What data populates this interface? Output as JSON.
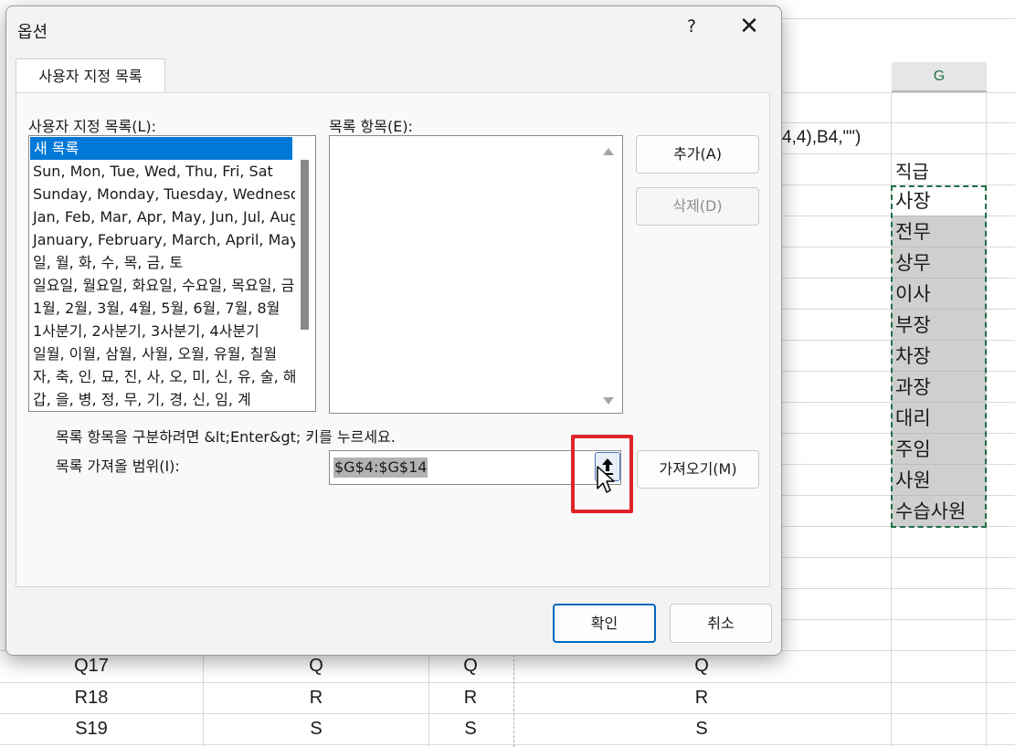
{
  "dialog": {
    "title": "옵션",
    "help_label": "?",
    "close_label": "✕",
    "tab_label": "사용자 지정 목록",
    "custom_lists_label": "사용자 지정 목록(L):",
    "custom_lists": [
      "새 목록",
      "Sun, Mon, Tue, Wed, Thu, Fri, Sat",
      "Sunday, Monday, Tuesday, Wednesday, Thursday, Friday, Saturday",
      "Jan, Feb, Mar, Apr, May, Jun, Jul, Aug, Sep, Oct, Nov, Dec",
      "January, February, March, April, May, June, July",
      "일, 월, 화, 수, 목, 금, 토",
      "일요일, 월요일, 화요일, 수요일, 목요일, 금요일, 토요일",
      "1월, 2월, 3월, 4월, 5월, 6월, 7월, 8월",
      "1사분기, 2사분기, 3사분기, 4사분기",
      "일월, 이월, 삼월, 사월, 오월, 유월, 칠월",
      "자, 축, 인, 묘, 진, 사, 오, 미, 신, 유, 술, 해",
      "갑, 을, 병, 정, 무, 기, 경, 신, 임, 계"
    ],
    "list_entries_label": "목록 항목(E):",
    "add_button": "추가(A)",
    "delete_button": "삭제(D)",
    "hint_text": "목록 항목을 구분하려면 &lt;Enter&gt; 키를 누르세요.",
    "import_range_label": "목록 가져올 범위(I):",
    "import_range_value": "$G$4:$G$14",
    "import_button": "가져오기(M)",
    "ok_button": "확인",
    "cancel_button": "취소"
  },
  "sheet": {
    "column_header": "G",
    "formula_fragment": "4,4),B4,\"\")",
    "g_header": "직급",
    "g_values": [
      "사장",
      "전무",
      "상무",
      "이사",
      "부장",
      "차장",
      "과장",
      "대리",
      "주임",
      "사원",
      "수습사원"
    ],
    "bottom_rows": [
      [
        "Q17",
        "Q",
        "Q",
        "Q"
      ],
      [
        "R18",
        "R",
        "R",
        "R"
      ],
      [
        "S19",
        "S",
        "S",
        "S"
      ]
    ]
  }
}
